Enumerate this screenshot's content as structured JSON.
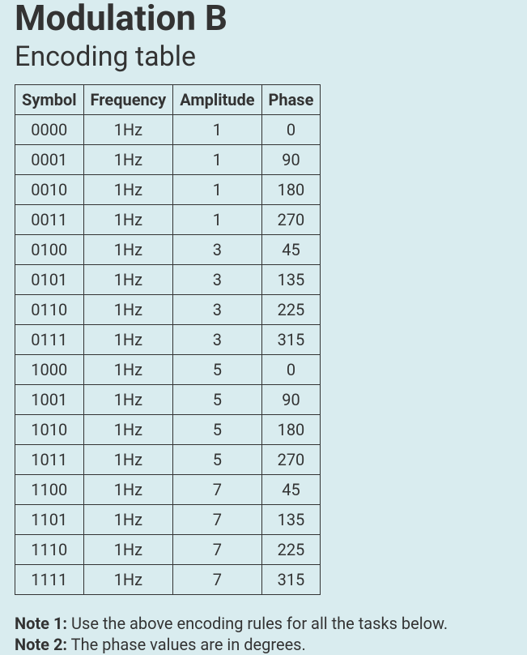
{
  "title": "Modulation B",
  "subtitle": "Encoding table",
  "table": {
    "headers": [
      "Symbol",
      "Frequency",
      "Amplitude",
      "Phase"
    ],
    "rows": [
      {
        "symbol": "0000",
        "frequency": "1Hz",
        "amplitude": "1",
        "phase": "0"
      },
      {
        "symbol": "0001",
        "frequency": "1Hz",
        "amplitude": "1",
        "phase": "90"
      },
      {
        "symbol": "0010",
        "frequency": "1Hz",
        "amplitude": "1",
        "phase": "180"
      },
      {
        "symbol": "0011",
        "frequency": "1Hz",
        "amplitude": "1",
        "phase": "270"
      },
      {
        "symbol": "0100",
        "frequency": "1Hz",
        "amplitude": "3",
        "phase": "45"
      },
      {
        "symbol": "0101",
        "frequency": "1Hz",
        "amplitude": "3",
        "phase": "135"
      },
      {
        "symbol": "0110",
        "frequency": "1Hz",
        "amplitude": "3",
        "phase": "225"
      },
      {
        "symbol": "0111",
        "frequency": "1Hz",
        "amplitude": "3",
        "phase": "315"
      },
      {
        "symbol": "1000",
        "frequency": "1Hz",
        "amplitude": "5",
        "phase": "0"
      },
      {
        "symbol": "1001",
        "frequency": "1Hz",
        "amplitude": "5",
        "phase": "90"
      },
      {
        "symbol": "1010",
        "frequency": "1Hz",
        "amplitude": "5",
        "phase": "180"
      },
      {
        "symbol": "1011",
        "frequency": "1Hz",
        "amplitude": "5",
        "phase": "270"
      },
      {
        "symbol": "1100",
        "frequency": "1Hz",
        "amplitude": "7",
        "phase": "45"
      },
      {
        "symbol": "1101",
        "frequency": "1Hz",
        "amplitude": "7",
        "phase": "135"
      },
      {
        "symbol": "1110",
        "frequency": "1Hz",
        "amplitude": "7",
        "phase": "225"
      },
      {
        "symbol": "1111",
        "frequency": "1Hz",
        "amplitude": "7",
        "phase": "315"
      }
    ]
  },
  "notes": [
    {
      "label": "Note 1:",
      "text": " Use the above encoding rules for all the tasks below."
    },
    {
      "label": "Note 2:",
      "text": " The phase values are in degrees."
    }
  ]
}
